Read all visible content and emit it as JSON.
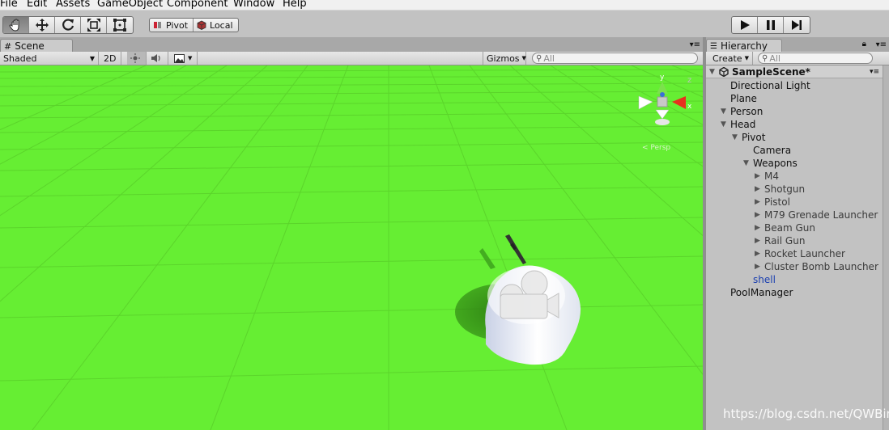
{
  "menu": [
    "File",
    "Edit",
    "Assets",
    "GameObject",
    "Component",
    "Window",
    "Help"
  ],
  "toolbar": {
    "tools": [
      "hand-icon",
      "move-icon",
      "rotate-icon",
      "scale-icon",
      "rect-icon"
    ],
    "pivot_label": "Pivot",
    "local_label": "Local",
    "play": [
      "play-icon",
      "pause-icon",
      "step-icon"
    ]
  },
  "scene": {
    "tab_label": "Scene",
    "shading_mode": "Shaded",
    "mode_2d": "2D",
    "gizmos_label": "Gizmos",
    "search_placeholder": "All",
    "gizmo_persp": "< Persp",
    "axis_y": "y",
    "axis_x": "x"
  },
  "hierarchy": {
    "tab_label": "Hierarchy",
    "create_label": "Create",
    "search_placeholder": "All",
    "scene_name": "SampleScene*",
    "items": [
      {
        "label": "Directional Light",
        "depth": 1,
        "arrow": false
      },
      {
        "label": "Plane",
        "depth": 1,
        "arrow": false
      },
      {
        "label": "Person",
        "depth": 1,
        "arrow": "down"
      },
      {
        "label": "Head",
        "depth": 2,
        "arrow": "down"
      },
      {
        "label": "Pivot",
        "depth": 3,
        "arrow": "down"
      },
      {
        "label": "Camera",
        "depth": 4,
        "arrow": false
      },
      {
        "label": "Weapons",
        "depth": 4,
        "arrow": "down"
      },
      {
        "label": "M4",
        "depth": 5,
        "arrow": "right"
      },
      {
        "label": "Shotgun",
        "depth": 5,
        "arrow": "right"
      },
      {
        "label": "Pistol",
        "depth": 5,
        "arrow": "right"
      },
      {
        "label": "M79 Grenade Launcher",
        "depth": 5,
        "arrow": "right"
      },
      {
        "label": "Beam Gun",
        "depth": 5,
        "arrow": "right"
      },
      {
        "label": "Rail Gun",
        "depth": 5,
        "arrow": "right"
      },
      {
        "label": "Rocket Launcher",
        "depth": 5,
        "arrow": "right"
      },
      {
        "label": "Cluster Bomb Launcher",
        "depth": 5,
        "arrow": "right"
      },
      {
        "label": "shell",
        "depth": 4,
        "arrow": false,
        "color": "#1a3fb0"
      },
      {
        "label": "PoolManager",
        "depth": 1,
        "arrow": false
      }
    ]
  },
  "watermark": "https://blog.csdn.net/QWBin",
  "colors": {
    "ground": "#66ee33",
    "grid": "#55d927",
    "panel": "#c2c2c2"
  }
}
